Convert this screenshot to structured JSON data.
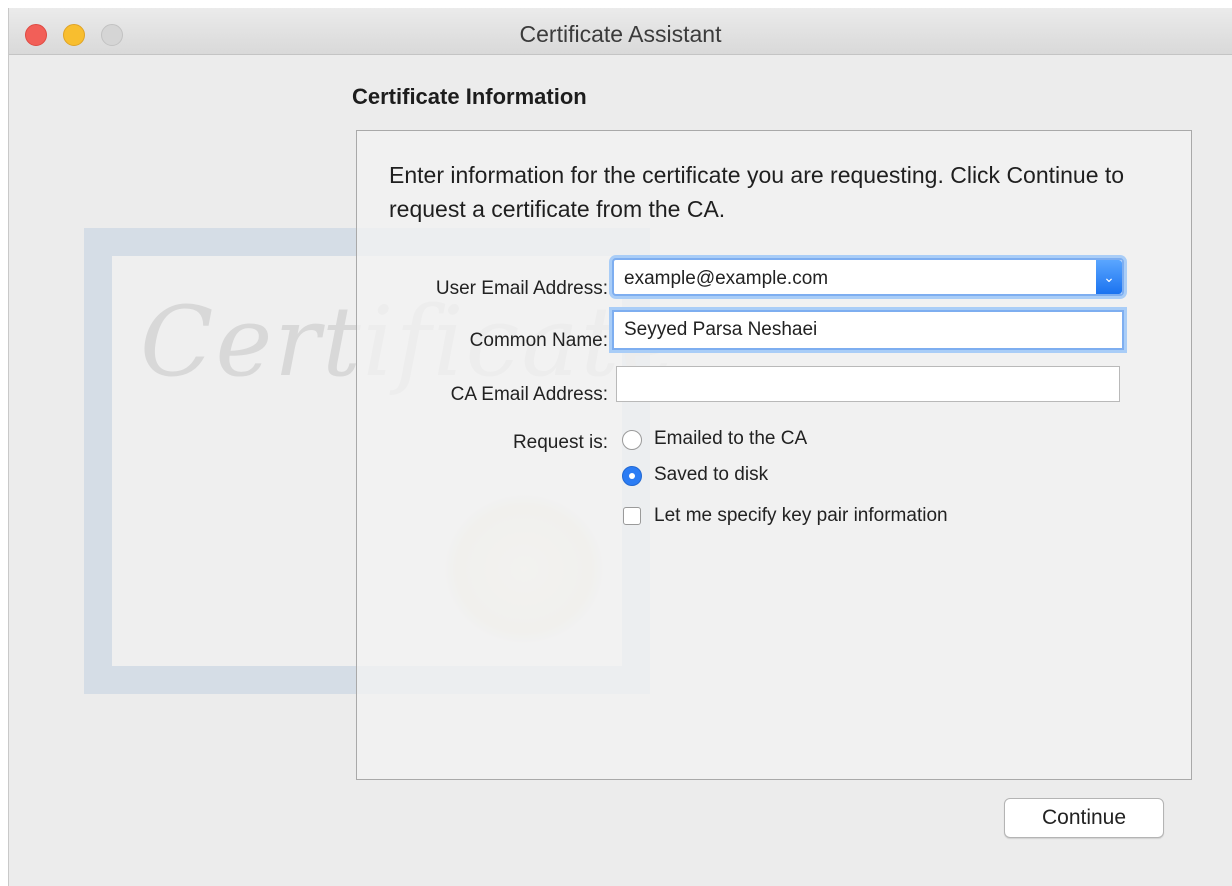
{
  "window": {
    "title": "Certificate Assistant"
  },
  "background_art": {
    "text": "Certificate"
  },
  "main": {
    "heading": "Certificate Information",
    "intro": "Enter information for the certificate you are requesting. Click Continue to request a certificate from the CA."
  },
  "form": {
    "user_email_label": "User Email Address:",
    "user_email_value": "example@example.com",
    "common_name_label": "Common Name:",
    "common_name_value": "Seyyed Parsa Neshaei",
    "ca_email_label": "CA Email Address:",
    "ca_email_value": "",
    "request_label": "Request is:",
    "options": [
      {
        "label": "Emailed to the CA",
        "selected": false
      },
      {
        "label": "Saved to disk",
        "selected": true
      }
    ],
    "keypair_label": "Let me specify key pair information",
    "keypair_checked": false
  },
  "buttons": {
    "continue": "Continue"
  },
  "colors": {
    "accent": "#2b7cf4",
    "close": "#f25f58",
    "minimize": "#f8be2f"
  }
}
